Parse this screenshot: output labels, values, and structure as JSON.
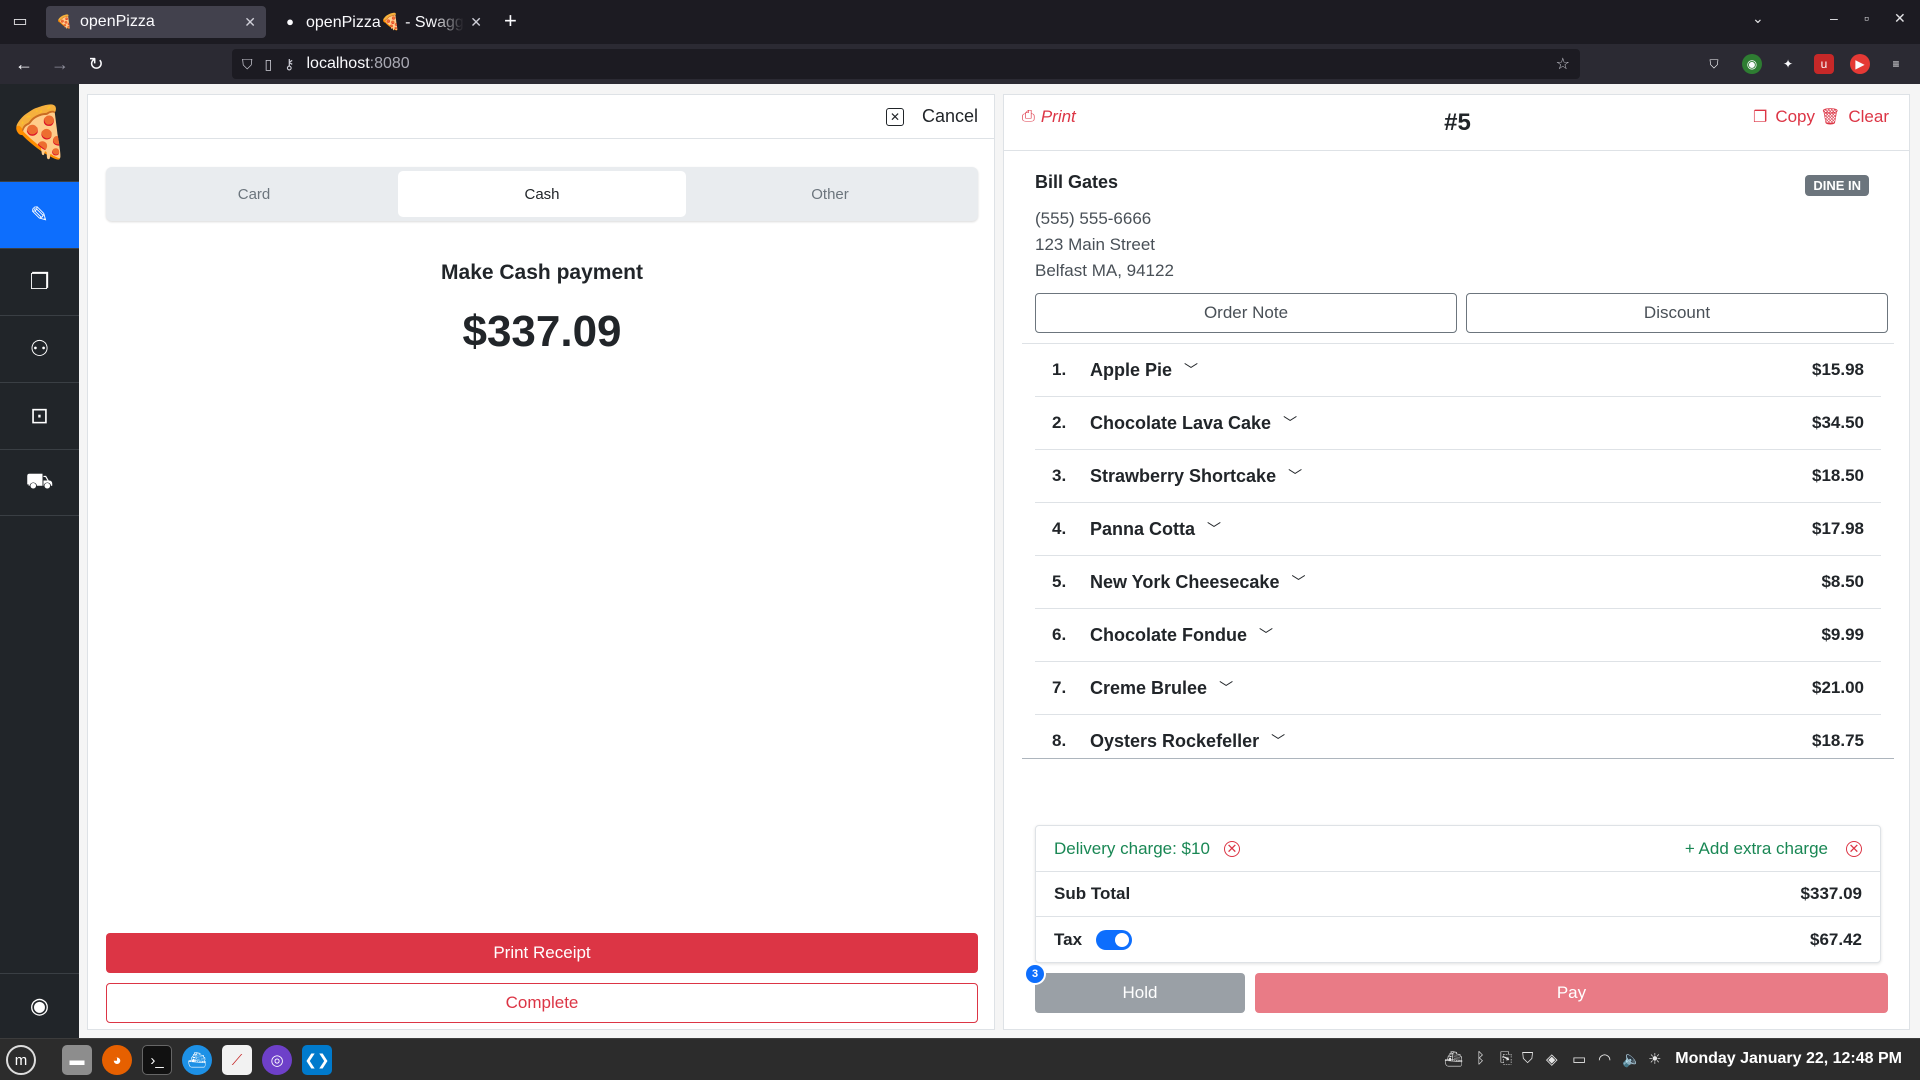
{
  "browser": {
    "tabs": [
      {
        "title": "openPizza",
        "favicon": "pizza-logo",
        "active": true
      },
      {
        "title": "openPizza🍕 - Swagger UI",
        "favicon": "swagger-logo",
        "active": false
      }
    ],
    "url_host": "localhost",
    "url_port": ":8080"
  },
  "sidebar": {
    "items": [
      {
        "icon": "edit-icon",
        "active": true
      },
      {
        "icon": "receipt-icon",
        "active": false
      },
      {
        "icon": "users-icon",
        "active": false
      },
      {
        "icon": "cash-icon",
        "active": false
      },
      {
        "icon": "truck-icon",
        "active": false
      }
    ],
    "bottom_icon": "user-circle-icon"
  },
  "payment": {
    "cancel_label": "Cancel",
    "methods": [
      "Card",
      "Cash",
      "Other"
    ],
    "selected_method": "Cash",
    "title": "Make Cash payment",
    "amount": "$337.09",
    "print_receipt_label": "Print Receipt",
    "complete_label": "Complete"
  },
  "order": {
    "print_label": "Print",
    "number": "#5",
    "copy_label": "Copy",
    "clear_label": "Clear",
    "customer": {
      "name": "Bill Gates",
      "phone": "(555) 555-6666",
      "street": "123 Main Street",
      "city": "Belfast MA, 94122"
    },
    "type_badge": "DINE IN",
    "order_note_label": "Order Note",
    "discount_label": "Discount",
    "items": [
      {
        "num": "1.",
        "name": "Apple Pie",
        "price": "$15.98"
      },
      {
        "num": "2.",
        "name": "Chocolate Lava Cake",
        "price": "$34.50"
      },
      {
        "num": "3.",
        "name": "Strawberry Shortcake",
        "price": "$18.50"
      },
      {
        "num": "4.",
        "name": "Panna Cotta",
        "price": "$17.98"
      },
      {
        "num": "5.",
        "name": "New York Cheesecake",
        "price": "$8.50"
      },
      {
        "num": "6.",
        "name": "Chocolate Fondue",
        "price": "$9.99"
      },
      {
        "num": "7.",
        "name": "Creme Brulee",
        "price": "$21.00"
      },
      {
        "num": "8.",
        "name": "Oysters Rockefeller",
        "price": "$18.75"
      }
    ],
    "delivery_charge": "Delivery charge: $10",
    "add_extra_charge": "+ Add extra charge",
    "subtotal_label": "Sub Total",
    "subtotal_value": "$337.09",
    "tax_label": "Tax",
    "tax_enabled": true,
    "tax_value": "$67.42",
    "hold_label": "Hold",
    "hold_count": "3",
    "pay_label": "Pay"
  },
  "taskbar": {
    "clock": "Monday January 22, 12:48 PM"
  },
  "colors": {
    "primary": "#0d6efd",
    "danger": "#dc3545",
    "success": "#198754",
    "sidebar": "#212529"
  }
}
